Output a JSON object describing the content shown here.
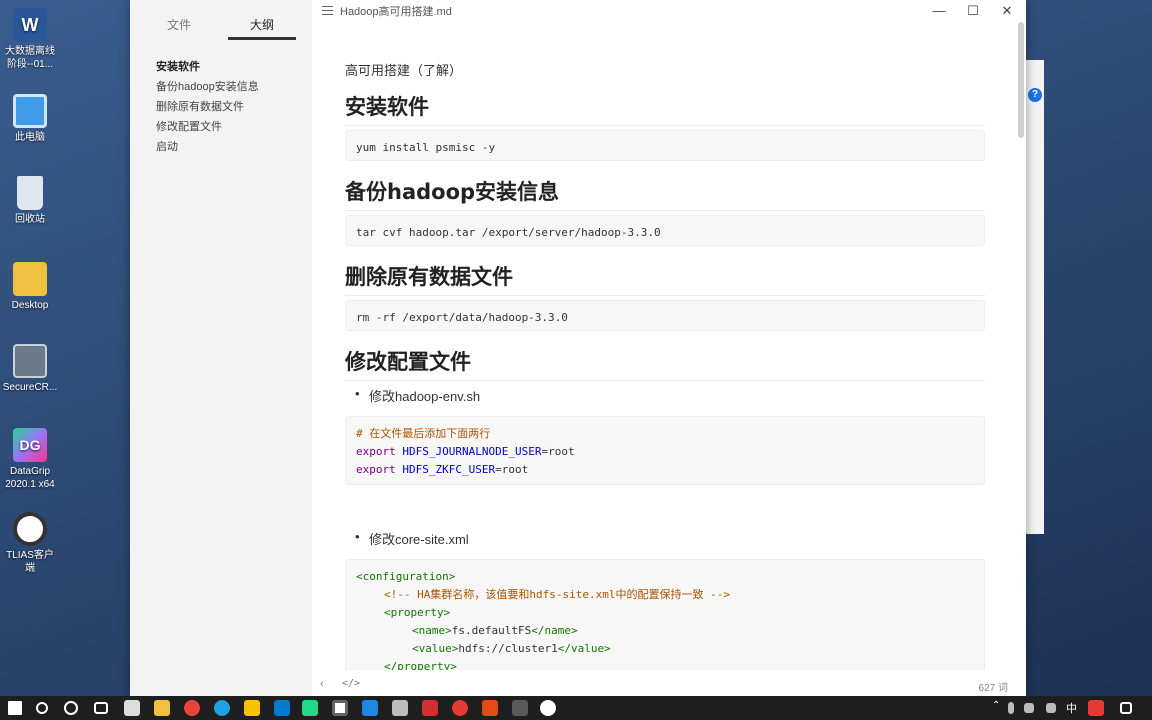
{
  "desktop": {
    "icons": [
      {
        "label": "大数据离线阶段--01..."
      },
      {
        "label": "此电脑"
      },
      {
        "label": "回收站"
      },
      {
        "label": "Desktop"
      },
      {
        "label": "SecureCR..."
      },
      {
        "label": "DataGrip 2020.1 x64"
      },
      {
        "label": "TLIAS客户端"
      }
    ]
  },
  "app": {
    "title": "Hadoop高可用搭建.md",
    "sidebar": {
      "tabs": [
        {
          "label": "文件"
        },
        {
          "label": "大纲"
        }
      ],
      "active_tab": "大纲",
      "outline": [
        {
          "label": "安装软件"
        },
        {
          "label": "备份hadoop安装信息"
        },
        {
          "label": "删除原有数据文件"
        },
        {
          "label": "修改配置文件"
        },
        {
          "label": "启动"
        }
      ]
    },
    "document": {
      "intro": "高可用搭建（了解）",
      "sections": [
        {
          "heading": "安装软件",
          "code": "yum install psmisc -y"
        },
        {
          "heading": "备份hadoop安装信息",
          "code": "tar cvf hadoop.tar /export/server/hadoop-3.3.0"
        },
        {
          "heading": "删除原有数据文件",
          "code": "rm -rf /export/data/hadoop-3.3.0"
        },
        {
          "heading": "修改配置文件"
        }
      ],
      "bullet_env": "修改hadoop-env.sh",
      "env_code": {
        "comment": "# 在文件最后添加下面两行",
        "line1_kw": "export",
        "line1_var": "HDFS_JOURNALNODE_USER",
        "line1_val": "=root",
        "line2_kw": "export",
        "line2_var": "HDFS_ZKFC_USER",
        "line2_val": "=root"
      },
      "bullet_core": "修改core-site.xml",
      "xml_code": {
        "l1": "<configuration>",
        "l2": "<!-- HA集群名称，该值要和hdfs-site.xml中的配置保持一致 -->",
        "l3": "<property>",
        "l4_open": "<name>",
        "l4_text": "fs.defaultFS",
        "l4_close": "</name>",
        "l5_open": "<value>",
        "l5_text": "hdfs://cluster1",
        "l5_close": "</value>",
        "l6": "</property>"
      }
    },
    "status": {
      "back": "‹",
      "source": "</>",
      "words": "627 词"
    },
    "window_buttons": {
      "minimize": "—",
      "maximize": "☐",
      "close": "✕"
    }
  },
  "taskbar": {
    "ime": "中",
    "colors": {
      "bg": "#1e1e1e"
    }
  },
  "colors": {
    "keyword": "#770088",
    "variable": "#0000cc",
    "comment": "#aa5500",
    "tag": "#117700"
  }
}
